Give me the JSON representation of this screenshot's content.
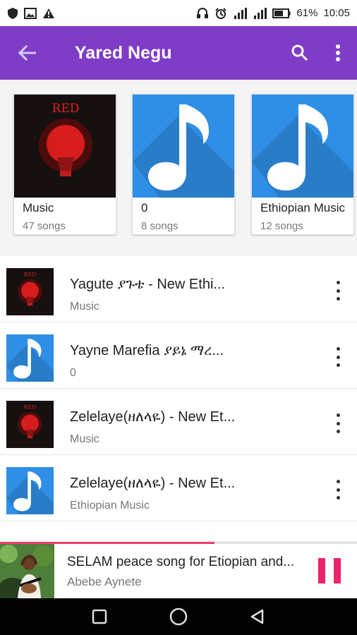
{
  "status": {
    "battery": "61%",
    "time": "10:05"
  },
  "header": {
    "title": "Yared Negu",
    "back_icon": "arrow-left-icon",
    "search_icon": "search-icon",
    "menu_icon": "more-vertical-icon"
  },
  "albums": [
    {
      "name": "Music",
      "count": "47 songs",
      "art": "red"
    },
    {
      "name": "0",
      "count": "8 songs",
      "art": "blue"
    },
    {
      "name": "Ethiopian Music",
      "count": "12 songs",
      "art": "blue"
    }
  ],
  "songs": [
    {
      "title": "Yagute  ያጉቴ - New Ethi...",
      "subtitle": "Music",
      "art": "red"
    },
    {
      "title": "Yayne Marefia  ያይኔ ማረ...",
      "subtitle": "0",
      "art": "blue"
    },
    {
      "title": "Zelelaye(ዘለላዬ) - New Et...",
      "subtitle": "Music",
      "art": "red"
    },
    {
      "title": "Zelelaye(ዘለላዬ) - New Et...",
      "subtitle": "Ethiopian Music",
      "art": "blue"
    }
  ],
  "player": {
    "title": "SELAM peace song for Etiopian and...",
    "artist": "Abebe Aynete",
    "progress": 0.6
  },
  "colors": {
    "appbar": "#7e3cc7",
    "accent": "#e9246c",
    "note_blue": "#2f8fe6"
  }
}
